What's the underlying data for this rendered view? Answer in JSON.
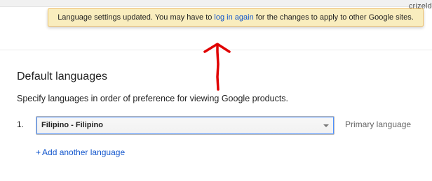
{
  "header": {
    "account_name": "crizeld"
  },
  "notice": {
    "text_before": "Language settings updated. You may have to ",
    "link_text": "log in again",
    "text_after": " for the changes to apply to other Google sites."
  },
  "languages": {
    "title": "Default languages",
    "description": "Specify languages in order of preference for viewing Google products.",
    "items": [
      {
        "index": "1.",
        "selected_value": "Filipino - Filipino",
        "role_label": "Primary language"
      }
    ],
    "add_plus": "+",
    "add_label": "Add another language"
  },
  "colors": {
    "notice_bg": "#f9edbe",
    "notice_border": "#f0c36d",
    "link": "#1155cc",
    "focus_ring": "#4d90fe",
    "annotation_arrow": "#e00000"
  },
  "icons": {
    "annotation": "red-arrow-icon",
    "dropdown": "chevron-down-icon"
  }
}
